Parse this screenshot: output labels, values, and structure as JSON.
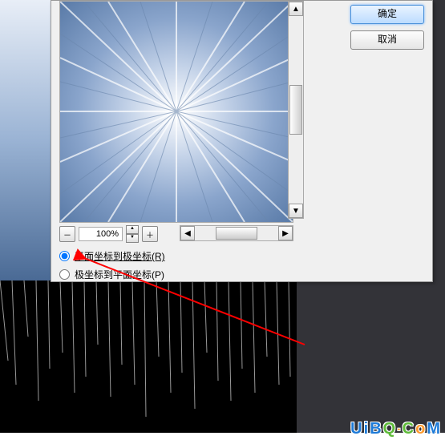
{
  "dialog": {
    "ok_label": "确定",
    "cancel_label": "取消",
    "zoom_value": "100%",
    "radio_rect_to_polar": "平面坐标到极坐标(R)",
    "radio_polar_to_rect": "极坐标到平面坐标(P)"
  },
  "watermark": {
    "text": "UiBQ.CoM"
  }
}
